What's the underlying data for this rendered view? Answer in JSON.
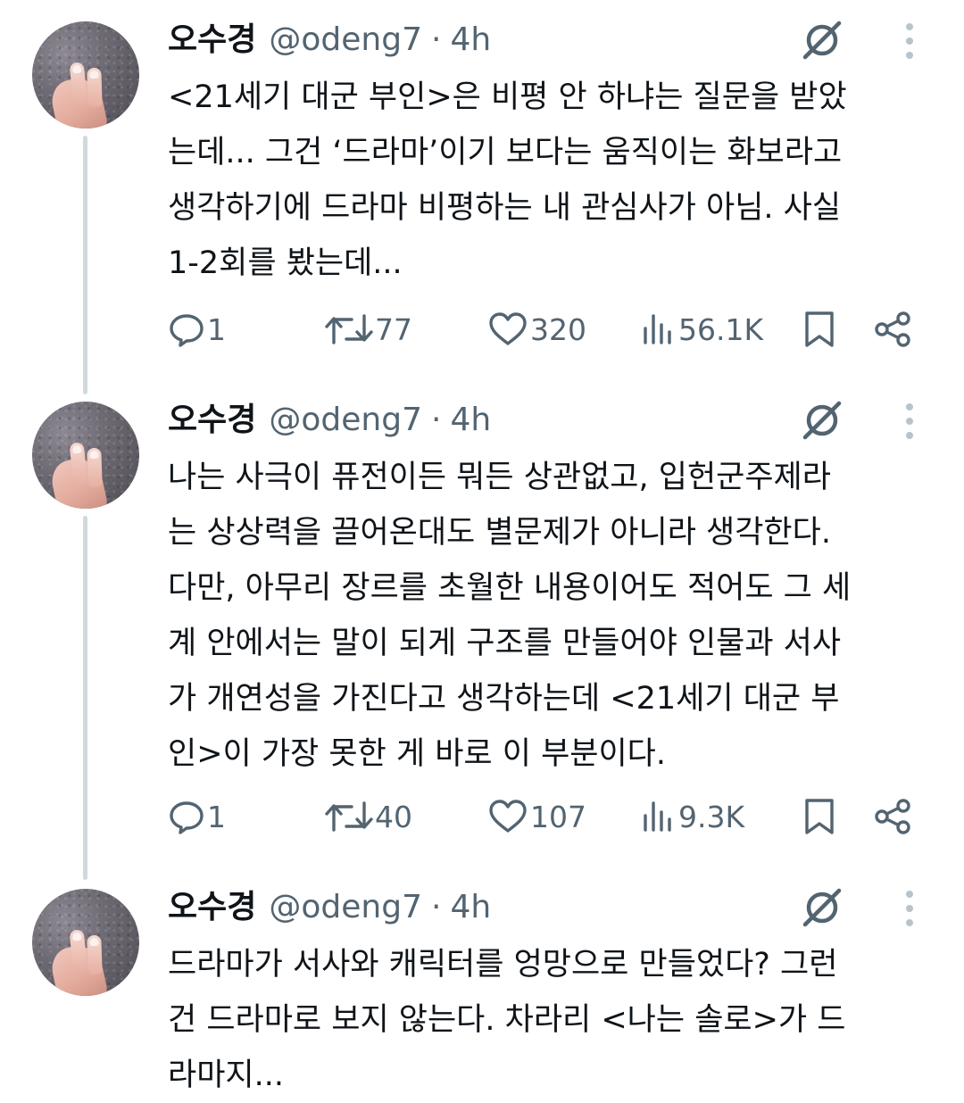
{
  "tweets": [
    {
      "name": "오수경",
      "handle": "@odeng7",
      "separator": "·",
      "time": "4h",
      "text": "<21세기 대군 부인>은 비평 안 하냐는 질문을 받았\n는데... 그건 ‘드라마’이기 보다는 움직이는 화보라고\n생각하기에 드라마 비평하는 내 관심사가 아님. 사실\n1-2회를 봤는데...",
      "replies": "1",
      "reposts": "77",
      "likes": "320",
      "views": "56.1K"
    },
    {
      "name": "오수경",
      "handle": "@odeng7",
      "separator": "·",
      "time": "4h",
      "text": "나는 사극이 퓨전이든 뭐든 상관없고, 입헌군주제라\n는 상상력을 끌어온대도 별문제가 아니라 생각한다.\n다만, 아무리 장르를 초월한 내용이어도 적어도 그 세\n계 안에서는 말이 되게 구조를 만들어야 인물과 서사\n가 개연성을 가진다고 생각하는데 <21세기 대군 부\n인>이 가장 못한 게 바로 이 부분이다.",
      "replies": "1",
      "reposts": "40",
      "likes": "107",
      "views": "9.3K"
    },
    {
      "name": "오수경",
      "handle": "@odeng7",
      "separator": "·",
      "time": "4h",
      "text": "드라마가 서사와 캐릭터를 엉망으로 만들었다? 그런\n건 드라마로 보지 않는다. 차라리 <나는 솔로>가 드\n라마지..."
    }
  ],
  "icons": {
    "reply": "reply-icon",
    "repost": "repost-icon",
    "like": "like-icon",
    "views": "views-icon",
    "bookmark": "bookmark-icon",
    "share": "share-icon",
    "grok": "grok-icon",
    "more": "more-icon"
  },
  "colors": {
    "text_primary": "#0f1419",
    "text_secondary": "#536471",
    "thread_line": "#cfd9de",
    "background": "#ffffff"
  }
}
